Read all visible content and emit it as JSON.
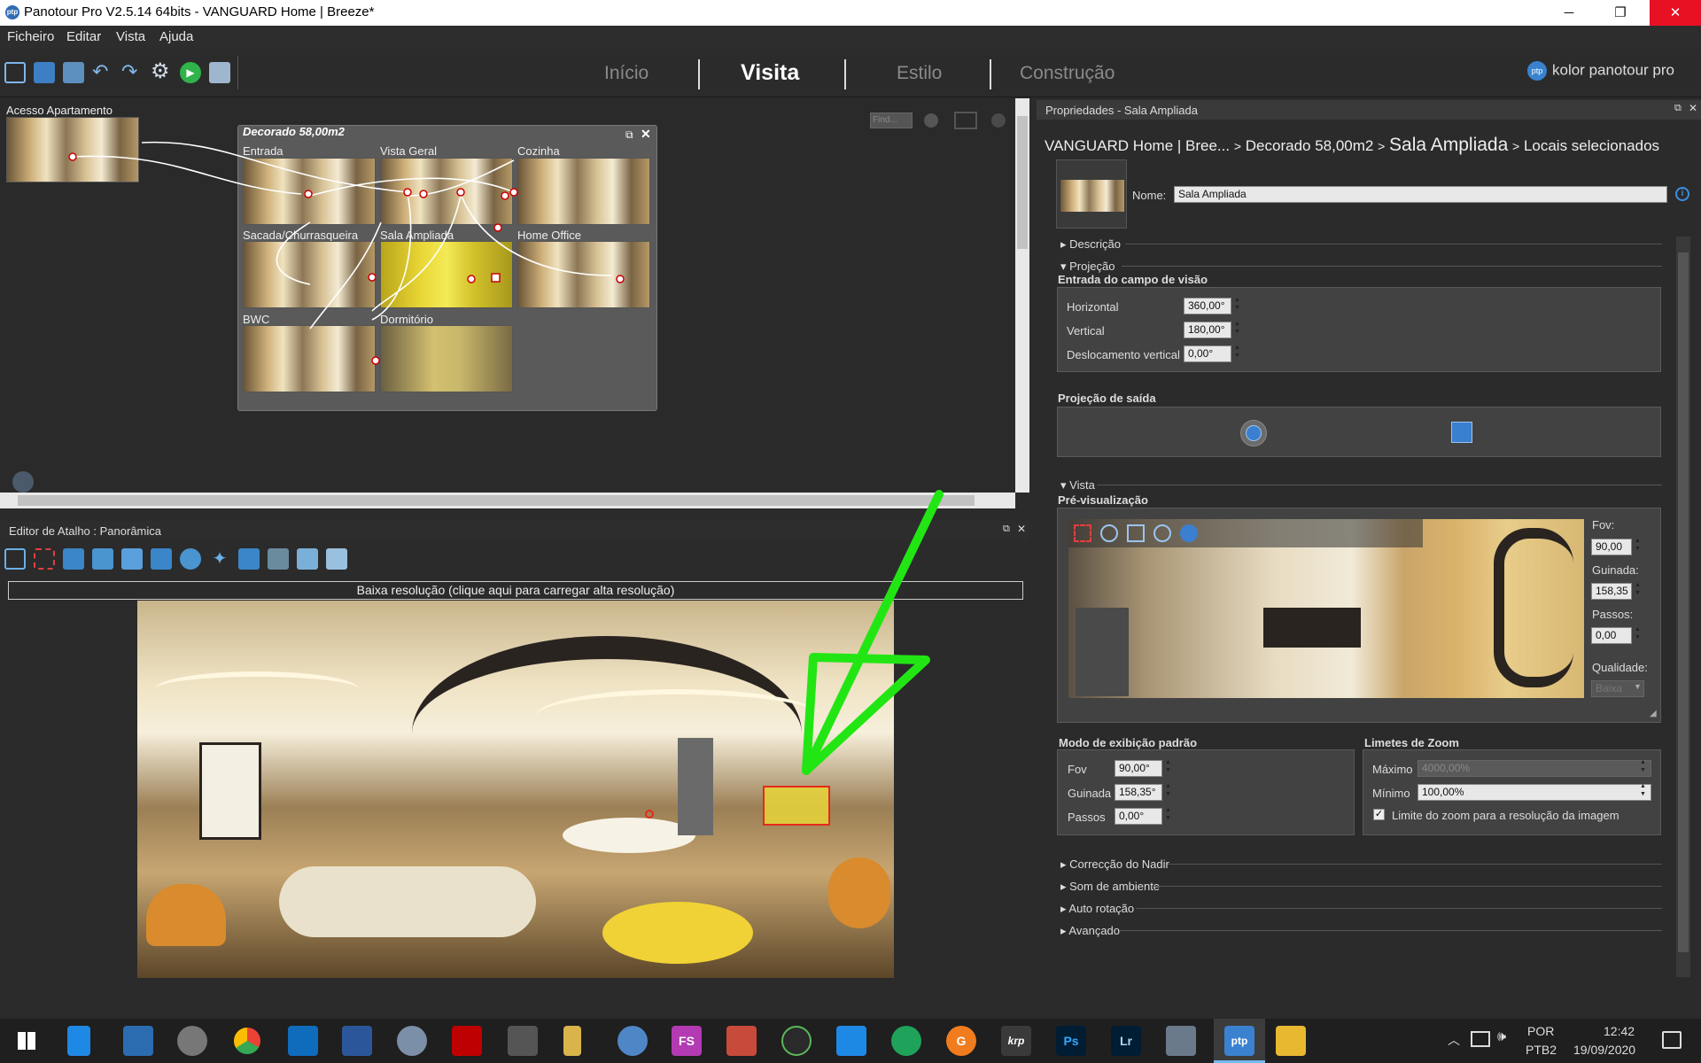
{
  "window": {
    "title": "Panotour Pro V2.5.14 64bits - VANGUARD Home | Breeze*",
    "minimize": "─",
    "maximize": "❐",
    "close": "✕"
  },
  "menu": [
    "Ficheiro",
    "Editar",
    "Vista",
    "Ajuda"
  ],
  "toolbar": {
    "icons": [
      "search-icon",
      "save-icon",
      "add-panorama-icon",
      "undo-icon",
      "redo-icon",
      "gear-icon",
      "play-icon",
      "folder-icon"
    ],
    "tabs": [
      "Início",
      "Visita",
      "Estilo",
      "Construção"
    ],
    "active_tab": "Visita",
    "brand": "kolor panotour pro",
    "brand_icon_text": "ptp"
  },
  "tour_graph": {
    "standalone": {
      "label": "Acesso Apartamento"
    },
    "group": {
      "title": "Decorado 58,00m2",
      "panoramas": [
        {
          "label": "Entrada",
          "selected": false
        },
        {
          "label": "Vista Geral",
          "selected": false
        },
        {
          "label": "Cozinha",
          "selected": false
        },
        {
          "label": "Sacada/Churrasqueira",
          "selected": false
        },
        {
          "label": "Sala Ampliada",
          "selected": true
        },
        {
          "label": "Home Office",
          "selected": false
        },
        {
          "label": "BWC",
          "selected": false
        },
        {
          "label": "Dormitório",
          "selected": true
        }
      ]
    },
    "find_placeholder": "Find..."
  },
  "hotspot_editor": {
    "title": "Editor de Atalho : Panorâmica",
    "lowres_banner": "Baixa resolução (clique aqui para carregar alta resolução)"
  },
  "properties": {
    "title": "Propriedades - Sala Ampliada",
    "breadcrumb": {
      "part1": "VANGUARD Home | Bree...",
      "sep": ">",
      "part2": "Decorado 58,00m2",
      "current": "Sala Ampliada",
      "part4": "Locais selecionados"
    },
    "name_label": "Nome:",
    "name_value": "Sala Ampliada",
    "descricao": "Descrição",
    "projecao": "Projeção",
    "fov_input_title": "Entrada do campo de visão",
    "horizontal_label": "Horizontal",
    "horizontal_value": "360,00°",
    "vertical_label": "Vertical",
    "vertical_value": "180,00°",
    "offset_label": "Deslocamento vertical",
    "offset_value": "0,00°",
    "output_proj_title": "Projeção de saída",
    "vista": "Vista",
    "preview_title": "Pré-visualização",
    "fov_label": "Fov:",
    "fov_value": "90,00",
    "guinada_label": "Guinada:",
    "guinada_value": "158,35",
    "passos_label": "Passos:",
    "passos_value": "0,00",
    "qualidade_label": "Qualidade:",
    "qualidade_value": "Baixa",
    "default_mode_title": "Modo de exibição padrão",
    "dm_fov_label": "Fov",
    "dm_fov_value": "90,00°",
    "dm_guinada_label": "Guinada",
    "dm_guinada_value": "158,35°",
    "dm_passos_label": "Passos",
    "dm_passos_value": "0,00°",
    "zoom_title": "Limetes de Zoom",
    "zoom_max_label": "Máximo",
    "zoom_max_value": "4000,00%",
    "zoom_min_label": "Mínimo",
    "zoom_min_value": "100,00%",
    "zoom_limit_label": "Limite do zoom para a resolução da imagem",
    "zoom_limit_checked": true,
    "collapsed_sections": [
      "Correcção do Nadir",
      "Som de ambiente",
      "Auto rotação",
      "Avançado"
    ]
  },
  "taskbar": {
    "apps": [
      "start-icon",
      "file-icon",
      "explorer-icon",
      "pro-icon",
      "chrome-icon",
      "outlook-icon",
      "word-icon",
      "paint-icon",
      "filezilla-icon",
      "app-icon",
      "note-icon",
      "blender-icon",
      "FS",
      "tool-icon",
      "pen-icon",
      "clip-icon",
      "wheel-icon",
      "G",
      "krp",
      "Ps",
      "Lr",
      "photo-icon",
      "ptp",
      "folder-icon"
    ],
    "lang": "POR",
    "lang2": "PTB2",
    "time": "12:42",
    "date": "19/09/2020"
  },
  "colors": {
    "accent_selected": "#e6d53a",
    "annotation_arrow": "#22e614",
    "close_red": "#e81123"
  }
}
